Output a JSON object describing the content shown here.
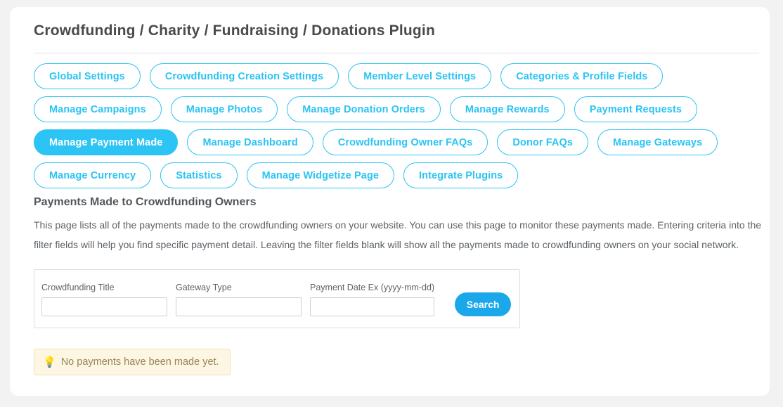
{
  "page": {
    "title": "Crowdfunding / Charity / Fundraising / Donations Plugin"
  },
  "colors": {
    "accent": "#2bc4f4",
    "button": "#1aa8ea",
    "notice_bg": "#fcf6e3",
    "notice_border": "#f2e2b8",
    "notice_text": "#9b8458",
    "page_bg": "#f2f2f2",
    "card_bg": "#ffffff"
  },
  "tabs": {
    "active_label": "Manage Payment Made",
    "rows": [
      [
        {
          "label": "Global Settings",
          "active": false
        },
        {
          "label": "Crowdfunding Creation Settings",
          "active": false
        },
        {
          "label": "Member Level Settings",
          "active": false
        },
        {
          "label": "Categories & Profile Fields",
          "active": false
        }
      ],
      [
        {
          "label": "Manage Campaigns",
          "active": false
        },
        {
          "label": "Manage Photos",
          "active": false
        },
        {
          "label": "Manage Donation Orders",
          "active": false
        },
        {
          "label": "Manage Rewards",
          "active": false
        },
        {
          "label": "Payment Requests",
          "active": false
        }
      ],
      [
        {
          "label": "Manage Payment Made",
          "active": true
        },
        {
          "label": "Manage Dashboard",
          "active": false
        },
        {
          "label": "Crowdfunding Owner FAQs",
          "active": false
        },
        {
          "label": "Donor FAQs",
          "active": false
        },
        {
          "label": "Manage Gateways",
          "active": false
        }
      ],
      [
        {
          "label": "Manage Currency",
          "active": false
        },
        {
          "label": "Statistics",
          "active": false
        },
        {
          "label": "Manage Widgetize Page",
          "active": false
        },
        {
          "label": "Integrate Plugins",
          "active": false
        }
      ]
    ]
  },
  "section": {
    "heading": "Payments Made to Crowdfunding Owners",
    "description": "This page lists all of the payments made to the crowdfunding owners on your website. You can use this page to monitor these payments made. Entering criteria into the filter fields will help you find specific payment detail. Leaving the filter fields blank will show all the payments made to crowdfunding owners on your social network."
  },
  "filter": {
    "fields": [
      {
        "label": "Crowdfunding Title",
        "value": "",
        "placeholder": ""
      },
      {
        "label": "Gateway Type",
        "value": "",
        "placeholder": ""
      },
      {
        "label": "Payment Date Ex (yyyy-mm-dd)",
        "value": "",
        "placeholder": ""
      }
    ],
    "search_label": "Search"
  },
  "notice": {
    "icon": "lightbulb-icon",
    "icon_glyph": "💡",
    "message": "No payments have been made yet."
  }
}
